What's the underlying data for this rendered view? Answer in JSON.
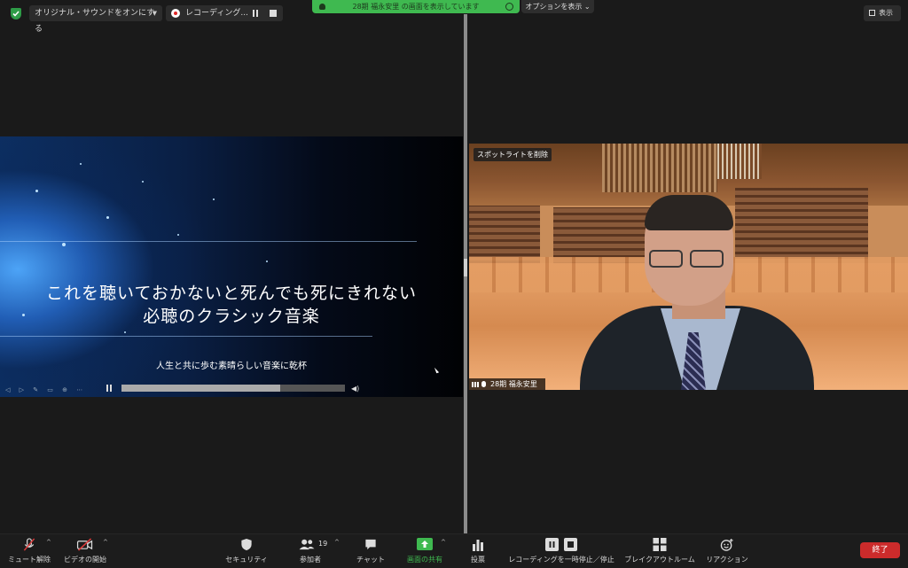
{
  "top_bar": {
    "original_sound_label": "オリジナル・サウンドをオンにする",
    "recording_label": "レコーディング...",
    "share_banner_text": "28期 福永安里 の画面を表示しています",
    "options_label": "オプションを表示",
    "view_label": "表示"
  },
  "shared_screen": {
    "title_line1": "これを聴いておかないと死んでも死にきれない",
    "title_line2": "必聴のクラシック音楽",
    "subtitle": "人生と共に歩む素晴らしい音楽に乾杯",
    "playback_progress": 0.71
  },
  "video": {
    "spotlight_button": "スポットライトを削除",
    "participant_name": "28期 福永安里"
  },
  "toolbar": {
    "items": [
      {
        "label": "ミュート解除",
        "icon": "mic-muted-icon"
      },
      {
        "label": "ビデオの開始",
        "icon": "video-off-icon"
      },
      {
        "label": "セキュリティ",
        "icon": "shield-icon"
      },
      {
        "label": "参加者",
        "icon": "participants-icon",
        "count": "19"
      },
      {
        "label": "チャット",
        "icon": "chat-icon"
      },
      {
        "label": "画面の共有",
        "icon": "share-screen-icon"
      },
      {
        "label": "投票",
        "icon": "poll-icon"
      },
      {
        "label": "レコーディングを一時停止／停止",
        "icon": "recording-controls-icon"
      },
      {
        "label": "ブレイクアウトルーム",
        "icon": "breakout-icon"
      },
      {
        "label": "リアクション",
        "icon": "reaction-icon"
      }
    ],
    "end_label": "終了"
  },
  "colors": {
    "share_green": "#3fb950",
    "end_red": "#cc2b2b",
    "background": "#1a1a1a"
  }
}
